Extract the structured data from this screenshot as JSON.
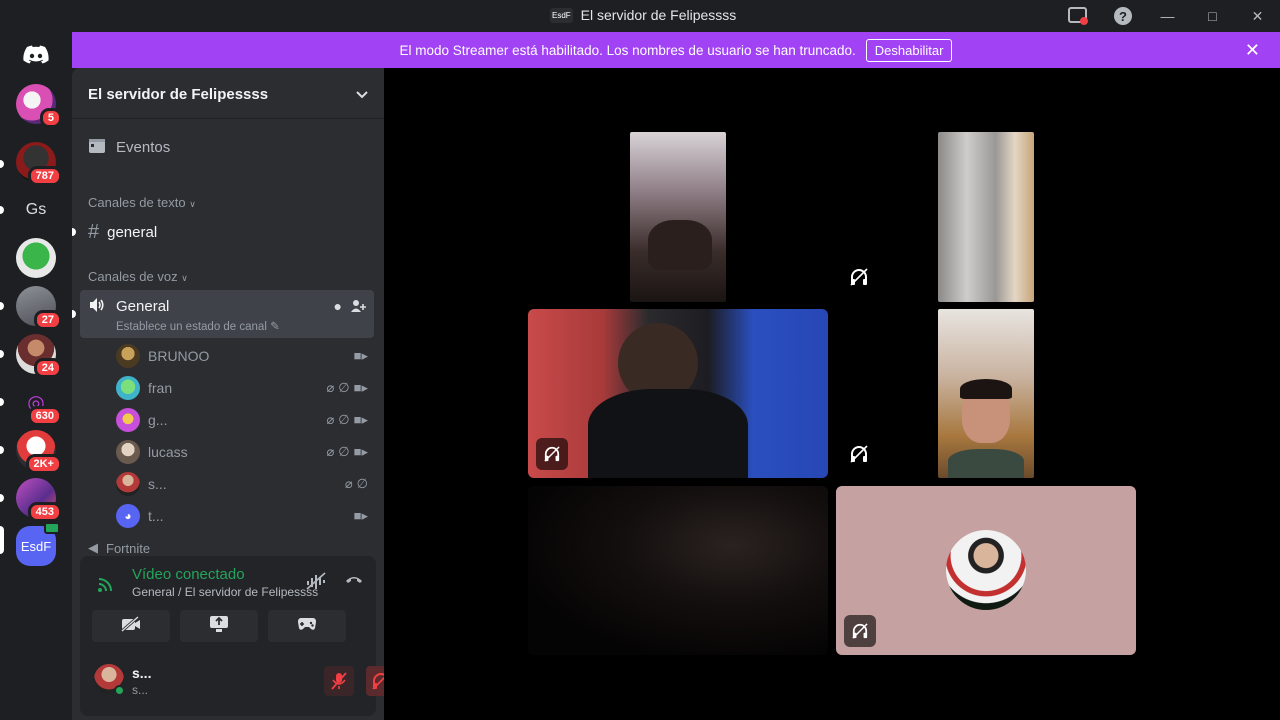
{
  "window": {
    "app_icon_label": "EsdF",
    "title": "El servidor de Felipessss"
  },
  "banner": {
    "text": "El modo Streamer está habilitado. Los nombres de usuario se han truncado.",
    "button_label": "Deshabilitar"
  },
  "servers": [
    {
      "badge": "5"
    },
    {
      "badge": "787"
    },
    {
      "label": "Gs"
    },
    {
      "badge": ""
    },
    {
      "badge": "27"
    },
    {
      "badge": "24"
    },
    {
      "badge": "630"
    },
    {
      "badge": "2K+"
    },
    {
      "badge": "453"
    },
    {
      "label": "EsdF"
    }
  ],
  "sidebar": {
    "server_name": "El servidor de Felipessss",
    "events_label": "Eventos",
    "text_category": "Canales de texto",
    "text_channel": "general",
    "voice_category": "Canales de voz",
    "voice_channel": {
      "name": "General",
      "status_placeholder": "Establece un estado de canal"
    },
    "partial_channel": "Fortnite",
    "members": [
      {
        "name": "BRUNOO"
      },
      {
        "name": "fran"
      },
      {
        "name": "g..."
      },
      {
        "name": "lucass"
      },
      {
        "name": "s..."
      },
      {
        "name": "t..."
      }
    ]
  },
  "voice_panel": {
    "title": "Vídeo conectado",
    "subtitle": "General / El servidor de Felipessss"
  },
  "user": {
    "name": "s...",
    "sub": "s..."
  },
  "colors": {
    "banner": "#a142f4",
    "connected": "#23a55a",
    "badge": "#f23f43",
    "muted_red": "#f23f43",
    "tile_pink": "#c6a1a1"
  }
}
